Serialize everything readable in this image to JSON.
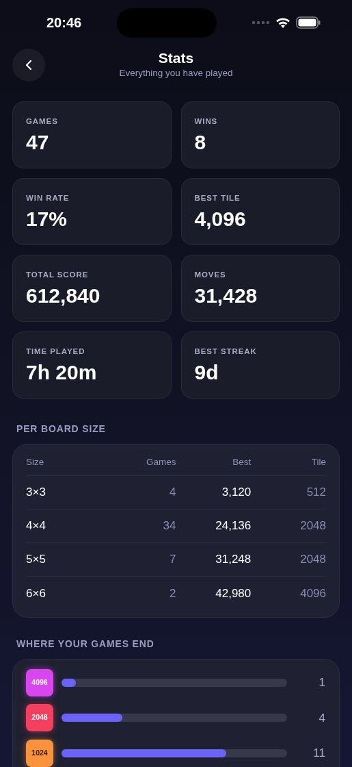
{
  "status_bar": {
    "time": "20:46"
  },
  "header": {
    "title": "Stats",
    "subtitle": "Everything you have played"
  },
  "stats": [
    {
      "label": "GAMES",
      "value": "47"
    },
    {
      "label": "WINS",
      "value": "8"
    },
    {
      "label": "WIN RATE",
      "value": "17%"
    },
    {
      "label": "BEST TILE",
      "value": "4,096"
    },
    {
      "label": "TOTAL SCORE",
      "value": "612,840"
    },
    {
      "label": "MOVES",
      "value": "31,428"
    },
    {
      "label": "TIME PLAYED",
      "value": "7h 20m"
    },
    {
      "label": "BEST STREAK",
      "value": "9d"
    }
  ],
  "board_sizes": {
    "title": "PER BOARD SIZE",
    "columns": [
      "Size",
      "Games",
      "Best",
      "Tile"
    ],
    "rows": [
      [
        "3×3",
        "4",
        "3,120",
        "512"
      ],
      [
        "4×4",
        "34",
        "24,136",
        "2048"
      ],
      [
        "5×5",
        "7",
        "31,248",
        "2048"
      ],
      [
        "6×6",
        "2",
        "42,980",
        "4096"
      ]
    ]
  },
  "game_ends": {
    "title": "WHERE YOUR GAMES END",
    "items": [
      {
        "tile": "4096",
        "color": "#d946ef",
        "dark_text": false,
        "level": 0.065,
        "count": "1"
      },
      {
        "tile": "2048",
        "color": "#f43f5e",
        "dark_text": false,
        "level": 0.27,
        "count": "4"
      },
      {
        "tile": "1024",
        "color": "#fb923c",
        "dark_text": true,
        "level": 0.73,
        "count": "11"
      }
    ]
  }
}
